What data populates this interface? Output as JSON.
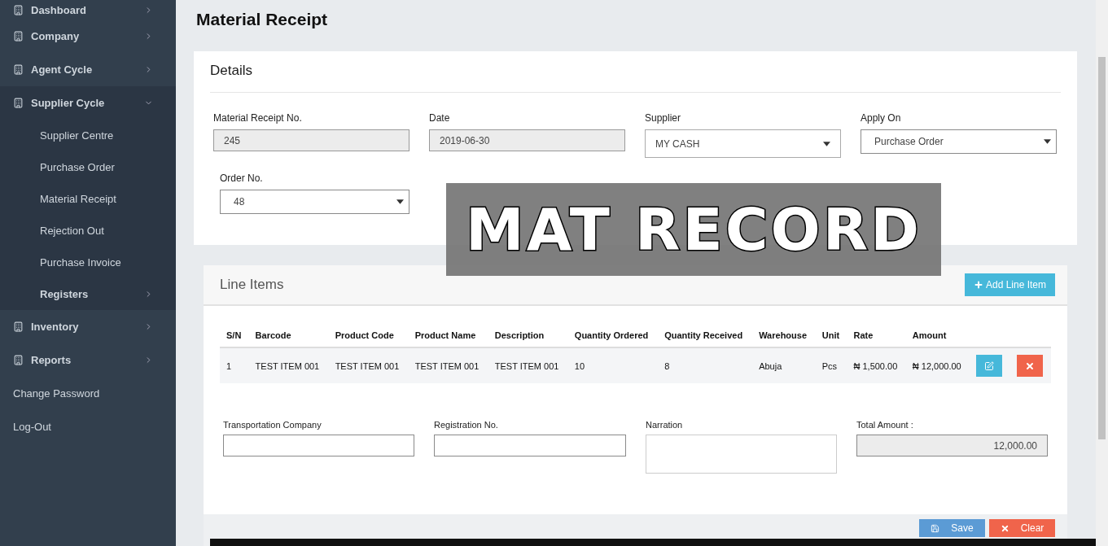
{
  "sidebar": {
    "items": [
      {
        "kind": "menu",
        "label": "Dashboard",
        "expanded": false
      },
      {
        "kind": "menu",
        "label": "Company",
        "expanded": false
      },
      {
        "kind": "menu",
        "label": "Agent Cycle",
        "expanded": false
      },
      {
        "kind": "menu",
        "label": "Supplier Cycle",
        "expanded": true,
        "children": [
          {
            "kind": "sub",
            "label": "Supplier Centre"
          },
          {
            "kind": "sub",
            "label": "Purchase Order"
          },
          {
            "kind": "sub",
            "label": "Material Receipt"
          },
          {
            "kind": "sub",
            "label": "Rejection Out"
          },
          {
            "kind": "sub",
            "label": "Purchase Invoice"
          },
          {
            "kind": "subgroup",
            "label": "Registers",
            "expanded": false
          }
        ]
      },
      {
        "kind": "menu",
        "label": "Inventory",
        "expanded": false
      },
      {
        "kind": "menu",
        "label": "Reports",
        "expanded": false
      },
      {
        "kind": "link",
        "label": "Change Password"
      },
      {
        "kind": "link",
        "label": "Log-Out"
      }
    ]
  },
  "page_title": "Material Receipt",
  "details": {
    "title": "Details",
    "fields": [
      {
        "kind": "readonly",
        "label": "Material Receipt No.",
        "value": "245"
      },
      {
        "kind": "readonly",
        "label": "Date",
        "value": "2019-06-30"
      },
      {
        "kind": "combo",
        "label": "Supplier",
        "value": "MY CASH"
      },
      {
        "kind": "select",
        "label": "Apply On",
        "value": "Purchase Order"
      },
      {
        "kind": "select",
        "label": "Order No.",
        "value": "48"
      }
    ]
  },
  "overlay_caption": "MAT RECORD",
  "line_items": {
    "title": "Line Items",
    "add_button": "Add Line Item",
    "columns": [
      "S/N",
      "Barcode",
      "Product Code",
      "Product Name",
      "Description",
      "Quantity Ordered",
      "Quantity Received",
      "Warehouse",
      "Unit",
      "Rate",
      "Amount"
    ],
    "rows": [
      [
        "1",
        "TEST ITEM 001",
        "TEST ITEM 001",
        "TEST ITEM 001",
        "TEST ITEM 001",
        "10",
        "8",
        "Abuja",
        "Pcs",
        "₦ 1,500.00",
        "₦ 12,000.00"
      ]
    ],
    "footer_fields": [
      {
        "kind": "text",
        "label": "Transportation Company"
      },
      {
        "kind": "text",
        "label": "Registration No."
      },
      {
        "kind": "textarea",
        "label": "Narration"
      },
      {
        "kind": "total",
        "label": "Total Amount :",
        "value": "12,000.00"
      }
    ],
    "buttons": [
      {
        "kind": "save",
        "label": "Save"
      },
      {
        "kind": "clear",
        "label": "Clear"
      }
    ]
  }
}
